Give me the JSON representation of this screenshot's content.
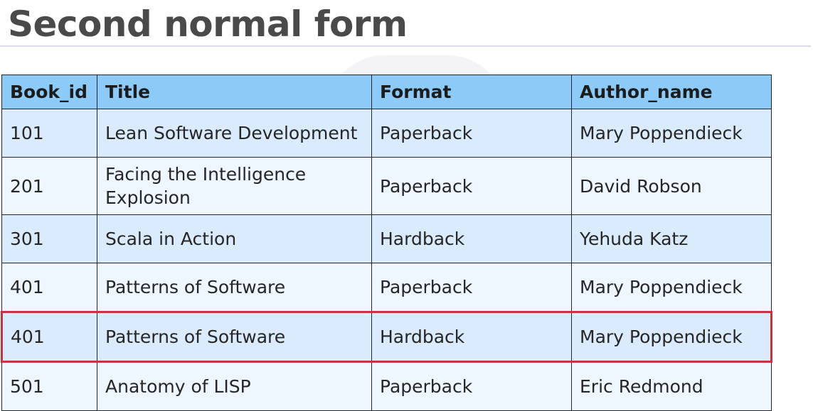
{
  "page": {
    "title": "Second normal form"
  },
  "table": {
    "headers": [
      "Book_id",
      "Title",
      "Format",
      "Author_name"
    ],
    "rows": [
      {
        "book_id": "101",
        "title": "Lean Software Development",
        "format": "Paperback",
        "author_name": "Mary Poppendieck"
      },
      {
        "book_id": "201",
        "title": "Facing the Intelligence Explosion",
        "format": "Paperback",
        "author_name": "David Robson"
      },
      {
        "book_id": "301",
        "title": "Scala in Action",
        "format": "Hardback",
        "author_name": "Yehuda Katz"
      },
      {
        "book_id": "401",
        "title": "Patterns of Software",
        "format": "Paperback",
        "author_name": "Mary Poppendieck"
      },
      {
        "book_id": "401",
        "title": "Patterns of Software",
        "format": "Hardback",
        "author_name": "Mary Poppendieck"
      },
      {
        "book_id": "501",
        "title": "Anatomy of LISP",
        "format": "Paperback",
        "author_name": "Eric Redmond"
      }
    ],
    "highlighted_row": 4
  },
  "colors": {
    "header_bg": "#8ccaf8",
    "row_bg_a": "#d9ebfc",
    "row_bg_b": "#eef6ff",
    "highlight_border": "#c8343d",
    "title_text": "#4a4a4a"
  }
}
